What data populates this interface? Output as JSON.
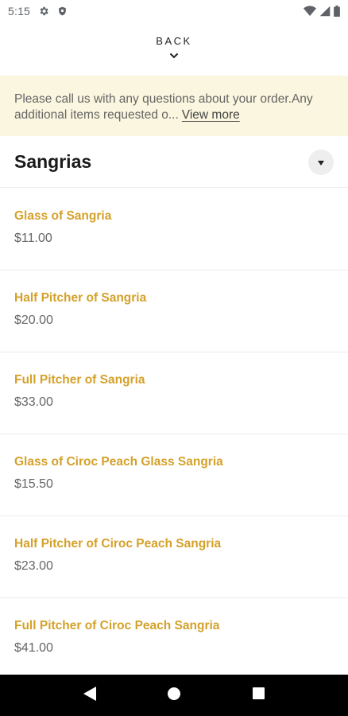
{
  "status_bar": {
    "time": "5:15",
    "icons": [
      "gear-icon",
      "shield-icon",
      "wifi-icon",
      "signal-icon",
      "battery-icon"
    ]
  },
  "header": {
    "back_label": "BACK"
  },
  "notice": {
    "text": "Please call us with any questions about your order.Any additional items requested o...",
    "link": "View more",
    "bg_color": "#faf6df"
  },
  "section": {
    "title": "Sangrias"
  },
  "items": [
    {
      "name": "Glass of Sangria",
      "price": "$11.00"
    },
    {
      "name": "Half Pitcher of Sangria",
      "price": "$20.00"
    },
    {
      "name": "Full Pitcher of Sangria",
      "price": "$33.00"
    },
    {
      "name": "Glass of Ciroc Peach Glass Sangria",
      "price": "$15.50"
    },
    {
      "name": "Half Pitcher of Ciroc Peach Sangria",
      "price": "$23.00"
    },
    {
      "name": "Full Pitcher of Ciroc Peach Sangria",
      "price": "$41.00"
    }
  ],
  "colors": {
    "accent": "#d4a12a",
    "price": "#666666"
  },
  "nav_bar": {
    "buttons": [
      "back-triangle-icon",
      "home-circle-icon",
      "recents-square-icon"
    ]
  }
}
